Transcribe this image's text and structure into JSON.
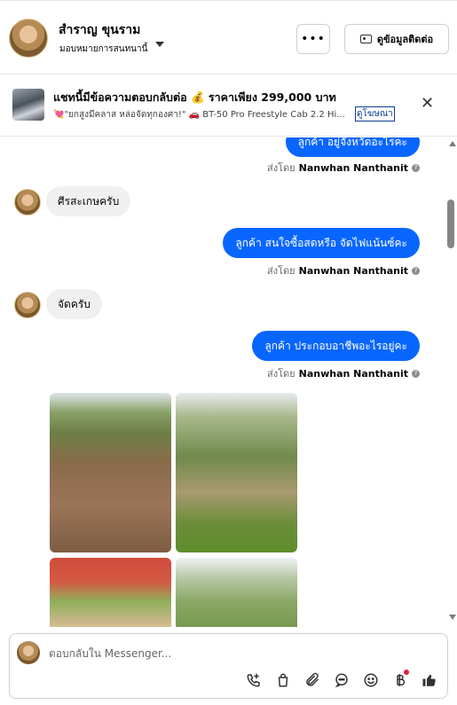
{
  "header": {
    "contact_name": "สำราญ ขุนราม",
    "assignment": "มอบหมายการสนทนานี้",
    "more_button": "•••",
    "contact_info_button": "ดูข้อมูลติดต่อ"
  },
  "ad_banner": {
    "title": "แชทนี้มีข้อความตอบกลับต่อ 💰 ราคาเพียง 299,000 บาท",
    "description": "💘\"ยกสูงมีคลาส หล่อจัดทุกองศา!\" 🚗 BT-50 Pro Freestyle Cab 2.2 Hi...",
    "link": "ดูโฆษณา"
  },
  "messages": [
    {
      "from": "page",
      "text": "ลูกค้า อยู่จังหวัดอะไรคะ",
      "sent_by_label": "ส่งโดย",
      "sender": "Nanwhan Nanthanit"
    },
    {
      "from": "contact",
      "text": "ศีรสะเกษครับ"
    },
    {
      "from": "page",
      "text": "ลูกค้า สนใจซื้อสดหรือ จัดไฟแน้นซ์คะ",
      "sent_by_label": "ส่งโดย",
      "sender": "Nanwhan Nanthanit"
    },
    {
      "from": "contact",
      "text": "จัดครับ"
    },
    {
      "from": "page",
      "text": "ลูกค้า ประกอบอาชีพอะไรอยู่คะ",
      "sent_by_label": "ส่งโดย",
      "sender": "Nanwhan Nanthanit"
    }
  ],
  "composer": {
    "placeholder": "ตอบกลับใน Messenger...",
    "tools": [
      "call-add-icon",
      "bag-icon",
      "paperclip-icon",
      "chat-bubble-icon",
      "emoji-icon",
      "baht-icon",
      "thumbs-up-icon"
    ]
  },
  "colors": {
    "accent": "#0866FF",
    "incoming_bubble": "#F0F0F0",
    "notification": "#E41E3F"
  }
}
